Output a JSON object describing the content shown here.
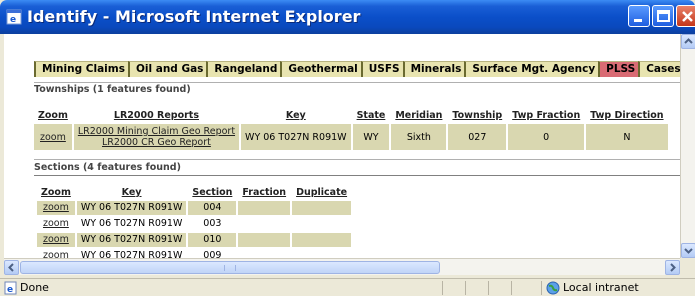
{
  "window": {
    "title": "Identify - Microsoft Internet Explorer"
  },
  "tabs": [
    {
      "label": "Mining Claims",
      "active": false
    },
    {
      "label": "Oil and Gas",
      "active": false
    },
    {
      "label": "Rangeland",
      "active": false
    },
    {
      "label": "Geothermal",
      "active": false
    },
    {
      "label": "USFS",
      "active": false
    },
    {
      "label": "Minerals",
      "active": false
    },
    {
      "label": "Surface Mgt. Agency",
      "active": false
    },
    {
      "label": "PLSS",
      "active": true
    },
    {
      "label": "Cases",
      "active": false
    }
  ],
  "townships": {
    "heading": "Townships (1 features found)",
    "columns": [
      "Zoom",
      "LR2000 Reports",
      "Key",
      "State",
      "Meridian",
      "Township",
      "Twp Fraction",
      "Twp Direction"
    ],
    "rows": [
      {
        "zoom": "zoom",
        "report1": "LR2000 Mining Claim Geo Report",
        "report2": "LR2000 CR Geo Report",
        "key": "WY 06 T027N R091W",
        "state": "WY",
        "meridian": "Sixth",
        "township": "027",
        "twp_fraction": "0",
        "twp_direction": "N"
      }
    ]
  },
  "sections": {
    "heading": "Sections (4 features found)",
    "columns": [
      "Zoom",
      "Key",
      "Section",
      "Fraction",
      "Duplicate"
    ],
    "rows": [
      {
        "zoom": "zoom",
        "key": "WY 06 T027N R091W",
        "section": "004",
        "fraction": "",
        "duplicate": ""
      },
      {
        "zoom": "zoom",
        "key": "WY 06 T027N R091W",
        "section": "003",
        "fraction": "",
        "duplicate": ""
      },
      {
        "zoom": "zoom",
        "key": "WY 06 T027N R091W",
        "section": "010",
        "fraction": "",
        "duplicate": ""
      },
      {
        "zoom": "zoom",
        "key": "WY 06 T027N R091W",
        "section": "009",
        "fraction": "",
        "duplicate": ""
      }
    ]
  },
  "statusbar": {
    "status_text": "Done",
    "zone_text": "Local intranet"
  },
  "colors": {
    "title_bar": "#0b4fc9",
    "tab_bg": "#e8e4b0",
    "tab_active": "#d96b74",
    "row_shade": "#d9d7b0"
  },
  "icons": {
    "title": "ie-window-icon",
    "status": "ie-page-icon",
    "zone": "globe-icon"
  }
}
